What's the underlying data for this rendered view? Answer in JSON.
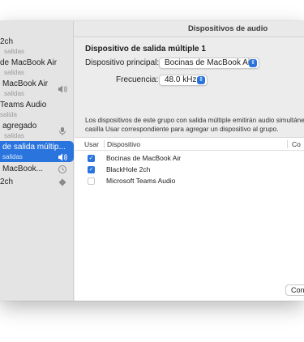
{
  "window": {
    "title": "Dispositivos de audio"
  },
  "sidebar": {
    "items": [
      {
        "name": "2ch",
        "sub": "salidas",
        "icon": ""
      },
      {
        "name": "de MacBook Air",
        "sub": "salidas",
        "icon": ""
      },
      {
        "name": "MacBook Air",
        "sub": "salidas",
        "icon": "speaker-icon"
      },
      {
        "name": "Teams Audio",
        "sub": "salida",
        "icon": ""
      },
      {
        "name": "agregado",
        "sub": "salidas",
        "icon": "microphone-icon"
      },
      {
        "name": "de salida múltip...",
        "sub": "salidas",
        "icon": "speaker-icon"
      },
      {
        "name": "MacBook...",
        "sub": "",
        "icon": "clock-icon"
      },
      {
        "name": "2ch",
        "sub": "",
        "icon": "diamond-icon"
      }
    ]
  },
  "main": {
    "heading": "Dispositivo de salida múltiple 1",
    "principal_label": "Dispositivo principal:",
    "principal_value": "Bocinas de MacBook Air",
    "frecuencia_label": "Frecuencia:",
    "frecuencia_value": "48.0 kHz",
    "desc_line1": "Los dispositivos de este grupo con salida múltiple emitirán audio simultáne",
    "desc_line2": "casilla Usar correspondiente para agregar un dispositivo al grupo.",
    "table": {
      "col_usar": "Usar",
      "col_dispositivo": "Dispositivo",
      "col_corr": "Co",
      "rows": [
        {
          "checked": true,
          "device": "Bocinas de MacBook Air"
        },
        {
          "checked": true,
          "device": "BlackHole 2ch"
        },
        {
          "checked": false,
          "device": "Microsoft Teams Audio"
        }
      ]
    },
    "footer_button": "Con"
  },
  "colors": {
    "accent": "#2a74de",
    "window_bg": "#ececec",
    "sidebar_bg": "#e4e4e4"
  }
}
